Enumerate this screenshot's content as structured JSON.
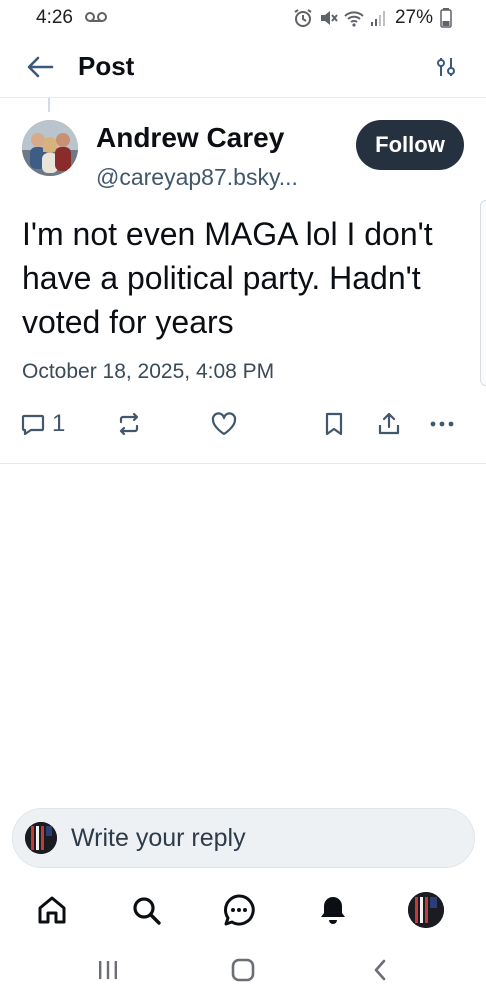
{
  "status_bar": {
    "time": "4:26",
    "voicemail_icon": "voicemail-icon",
    "battery": "27%",
    "icons": [
      "alarm-icon",
      "mute-icon",
      "wifi-icon",
      "signal-icon",
      "battery-icon"
    ]
  },
  "header": {
    "title": "Post",
    "back_icon": "back-arrow-icon",
    "filter_icon": "sliders-icon"
  },
  "post": {
    "author_name": "Andrew Carey",
    "author_handle": "@careyap87.bsky...",
    "follow_label": "Follow",
    "text": "I'm not even MAGA lol I don't have a political party. Hadn't voted for years",
    "date": "October 18, 2025, 4:08 PM",
    "actions": {
      "reply_count": "1",
      "reply_icon": "reply-icon",
      "repost_icon": "repost-icon",
      "like_icon": "heart-icon",
      "bookmark_icon": "bookmark-icon",
      "share_icon": "share-icon",
      "more_icon": "more-icon"
    }
  },
  "reply": {
    "placeholder": "Write your reply"
  },
  "tabbar": {
    "items": [
      "home-icon",
      "search-icon",
      "chat-icon",
      "bell-icon",
      "profile-avatar"
    ]
  },
  "system_nav": {
    "items": [
      "recents-icon",
      "home-button-icon",
      "back-icon"
    ]
  },
  "colors": {
    "accent": "#3a5a7c",
    "follow_bg": "#25313f",
    "text": "#0b0f14",
    "muted": "#42576c"
  }
}
